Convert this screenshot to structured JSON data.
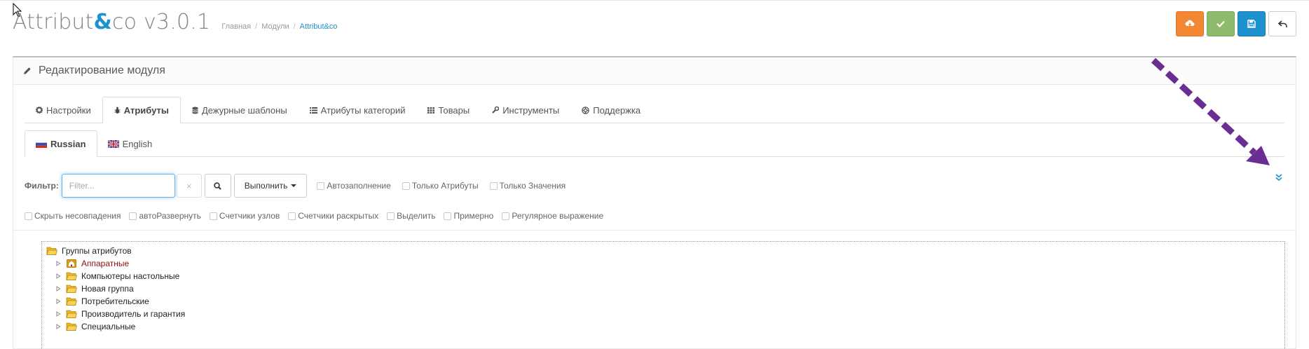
{
  "header": {
    "title_prefix": "Attribut",
    "title_amp": "&",
    "title_suffix": "co v3.0.1",
    "breadcrumb": [
      "Главная",
      "Модули",
      "Attribut&co"
    ],
    "buttons": [
      {
        "icon": "cloud-download-icon",
        "color": "#f38733"
      },
      {
        "icon": "check-icon",
        "color": "#8fbb6c"
      },
      {
        "icon": "save-icon",
        "color": "#1e91cf"
      },
      {
        "icon": "back-icon",
        "color": "#ffffff"
      }
    ]
  },
  "panel": {
    "title": "Редактирование модуля",
    "icon": "pencil-icon"
  },
  "tabs": [
    {
      "label": "Настройки",
      "icon": "gear-icon",
      "active": false
    },
    {
      "label": "Атрибуты",
      "icon": "bug-icon",
      "active": true
    },
    {
      "label": "Дежурные шаблоны",
      "icon": "database-icon",
      "active": false
    },
    {
      "label": "Атрибуты категорий",
      "icon": "list-icon",
      "active": false
    },
    {
      "label": "Товары",
      "icon": "grid-icon",
      "active": false
    },
    {
      "label": "Инструменты",
      "icon": "wrench-icon",
      "active": false
    },
    {
      "label": "Поддержка",
      "icon": "lifebuoy-icon",
      "active": false
    }
  ],
  "language_tabs": [
    {
      "label": "Russian",
      "flag": "flag-ru-icon",
      "active": true
    },
    {
      "label": "English",
      "flag": "flag-gb-icon",
      "active": false
    }
  ],
  "filter": {
    "label": "Фильтр:",
    "placeholder": "Filter...",
    "value": "",
    "clear_label": "×",
    "execute_label": "Выполнить",
    "options_row1": [
      {
        "label": "Автозаполнение",
        "checked": false
      },
      {
        "label": "Только Атрибуты",
        "checked": false
      },
      {
        "label": "Только Значения",
        "checked": false
      }
    ],
    "options_row2": [
      {
        "label": "Скрыть несовпадения",
        "checked": false
      },
      {
        "label": "автоРазвернуть",
        "checked": false
      },
      {
        "label": "Счетчики узлов",
        "checked": false
      },
      {
        "label": "Счетчики раскрытых",
        "checked": false
      },
      {
        "label": "Выделить",
        "checked": false
      },
      {
        "label": "Примерно",
        "checked": false
      },
      {
        "label": "Регулярное выражение",
        "checked": false
      }
    ]
  },
  "tree": {
    "root": "Группы атрибутов",
    "items": [
      {
        "label": "Аппаратные",
        "icon": "home-folder-icon"
      },
      {
        "label": "Компьютеры настольные",
        "icon": "folder-icon"
      },
      {
        "label": "Новая группа",
        "icon": "folder-icon"
      },
      {
        "label": "Потребительские",
        "icon": "folder-icon"
      },
      {
        "label": "Производитель и гарантия",
        "icon": "folder-icon"
      },
      {
        "label": "Специальные",
        "icon": "folder-icon"
      }
    ]
  },
  "annotation": {
    "arrow_color": "#6a2d91"
  }
}
